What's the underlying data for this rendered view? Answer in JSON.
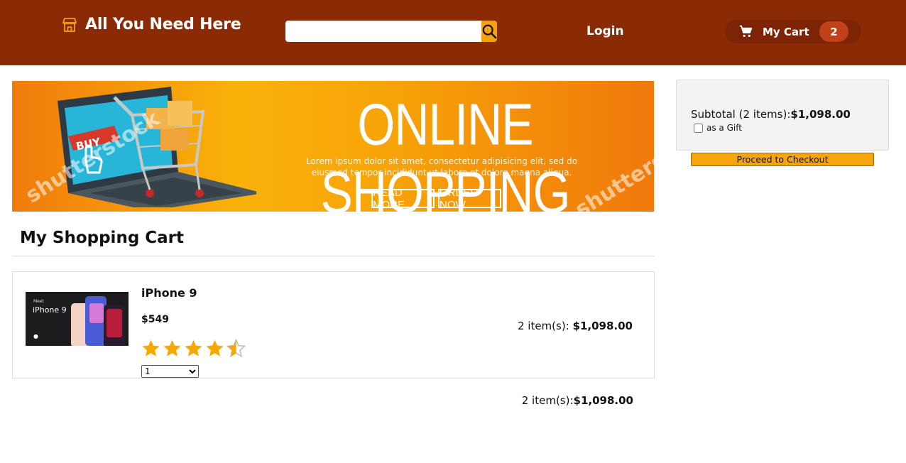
{
  "header": {
    "brand": "All You Need Here",
    "search": {
      "value": "",
      "placeholder": ""
    },
    "login_label": "Login",
    "cart_label": "My Cart",
    "cart_count": "2",
    "colors": {
      "header_bg": "#8a2b06",
      "accent": "#f5a00d"
    }
  },
  "banner": {
    "headline": "ONLINE SHOPPING",
    "body": "Lorem ipsum dolor sit amet, consectetur adipisicing elit, sed do eiusmod tempor incididunt ut labore et dolore magna aliqua.",
    "read_more": "READ MORE",
    "order_now": "ORDER NOW",
    "buy_tag": "BUY",
    "watermark": "shutterstock"
  },
  "cart": {
    "title": "My Shopping Cart",
    "items": [
      {
        "name": "iPhone 9",
        "price": "$549",
        "rating": 4.5,
        "rating_max": 5,
        "image_text_meet": "Meet",
        "image_text_model": "iPhone 9",
        "quantity_selected": "1",
        "total_prefix": "2 item(s):",
        "total_amount": "$1,098.00"
      }
    ],
    "grand_total_prefix": "2 item(s):",
    "grand_total_amount": "$1,098.00"
  },
  "summary": {
    "subtotal_prefix": "Subtotal (2 items):",
    "subtotal_amount": "$1,098.00",
    "gift_label": "as a Gift",
    "gift_checked": false,
    "checkout_label": "Proceed to Checkout"
  },
  "icons": {
    "logo": "store-icon",
    "search": "search-icon",
    "cart": "shopping-cart-icon",
    "star": "star-icon"
  }
}
